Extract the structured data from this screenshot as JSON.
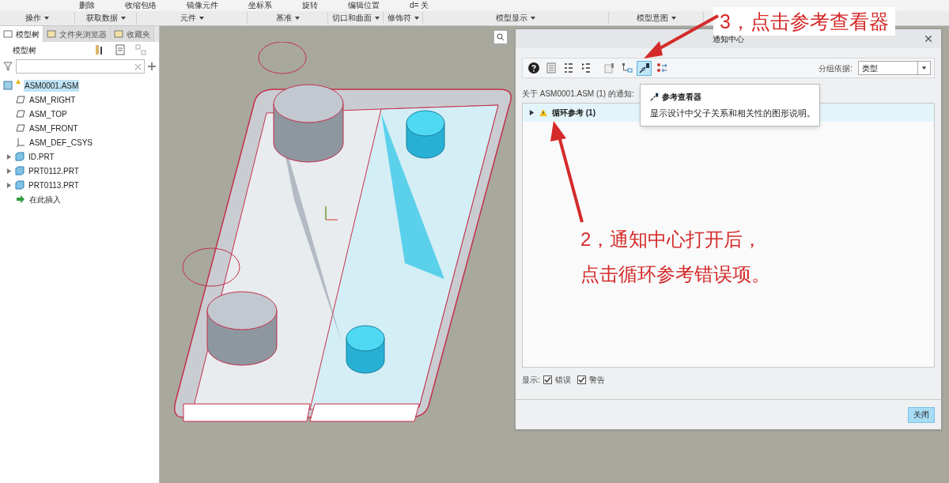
{
  "ribbon": {
    "commands": [
      "删除",
      "收缩包络",
      "镜像元件",
      "坐标系",
      "旋转",
      "编辑位置",
      "d= 关"
    ],
    "groups": [
      "操作",
      "获取数据",
      "元件",
      "基准",
      "切口和曲面",
      "修饰符",
      "模型显示",
      "模型意图"
    ]
  },
  "side_tabs": [
    {
      "label": "模型树",
      "selected": true
    },
    {
      "label": "文件夹浏览器",
      "selected": false
    },
    {
      "label": "收藏夹",
      "selected": false
    }
  ],
  "tree_title": "模型树",
  "tree": [
    {
      "kind": "assembly",
      "label": "ASM0001.ASM",
      "selected": true,
      "warning": true,
      "children": [
        {
          "kind": "plane",
          "label": "ASM_RIGHT",
          "selected": false
        },
        {
          "kind": "plane",
          "label": "ASM_TOP",
          "selected": false
        },
        {
          "kind": "plane",
          "label": "ASM_FRONT",
          "selected": false
        },
        {
          "kind": "csys",
          "label": "ASM_DEF_CSYS",
          "selected": false
        },
        {
          "kind": "part",
          "label": "ID.PRT",
          "selected": false,
          "expanded": false
        },
        {
          "kind": "part",
          "label": "PRT0112.PRT",
          "selected": false,
          "expanded": false
        },
        {
          "kind": "part",
          "label": "PRT0113.PRT",
          "selected": false,
          "expanded": false
        },
        {
          "kind": "insert",
          "label": "在此插入",
          "selected": false
        }
      ]
    }
  ],
  "dialog": {
    "title": "通知中心",
    "tools": [
      {
        "kind": "help",
        "selected": false
      },
      {
        "kind": "details",
        "selected": false
      },
      {
        "kind": "collapse",
        "selected": false
      },
      {
        "kind": "expand",
        "selected": false
      },
      {
        "kind": "page",
        "selected": false
      },
      {
        "kind": "tree",
        "selected": false
      },
      {
        "kind": "chain",
        "selected": true
      },
      {
        "kind": "swap",
        "selected": false
      }
    ],
    "group_by_label": "分组依据:",
    "group_by_value": "类型",
    "about": "关于 ASM0001.ASM (1) 的通知:",
    "items": [
      {
        "label": "循环参考 (1)",
        "expanded": false
      }
    ],
    "tooltip": {
      "title": "参考查看器",
      "text": "显示设计中父子关系和相关性的图形说明。"
    },
    "show_label": "显示:",
    "filters": [
      {
        "label": "错误",
        "checked": true
      },
      {
        "label": "警告",
        "checked": true
      }
    ],
    "close_button": "关闭"
  },
  "annotations": {
    "step3": "3，点击参考查看器",
    "step2": [
      "2，通知中心打开后，",
      "点击循环参考错误项。"
    ]
  }
}
